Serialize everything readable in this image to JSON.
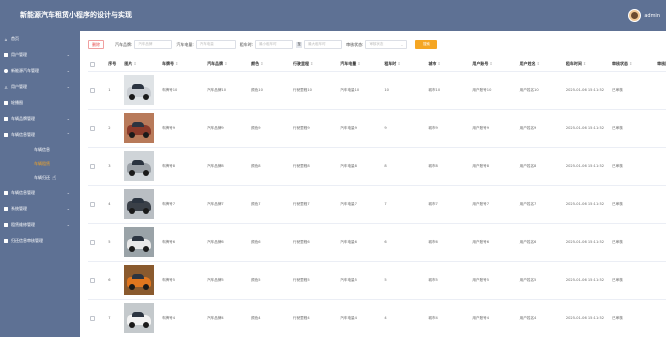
{
  "app": {
    "title": "新能源汽车租赁小程序的设计与实现",
    "user_name": "admin",
    "accent_color": "#f5a623",
    "theme_color": "#5e7194"
  },
  "sidebar": {
    "items": [
      {
        "label": "首页",
        "icon": "home-icon"
      },
      {
        "label": "用户管理",
        "icon": "users-icon",
        "has_children": true
      },
      {
        "label": "新能源汽车管理",
        "icon": "car-icon",
        "has_children": true
      },
      {
        "label": "用户管理",
        "icon": "person-icon",
        "has_children": true
      },
      {
        "label": "轮播图",
        "icon": "image-icon"
      },
      {
        "label": "车辆品牌管理",
        "icon": "tag-icon",
        "has_children": true
      },
      {
        "label": "车辆信息管理",
        "icon": "list-icon",
        "has_children": true,
        "expanded": true,
        "children": [
          {
            "label": "车辆信息",
            "active": false
          },
          {
            "label": "车辆租赁",
            "active": true
          },
          {
            "label": "车辆归还",
            "active": false
          }
        ]
      },
      {
        "label": "车辆信息管理",
        "icon": "list-icon",
        "has_children": true
      },
      {
        "label": "系统管理",
        "icon": "settings-icon",
        "has_children": true
      },
      {
        "label": "租赁维修管理",
        "icon": "wrench-icon",
        "has_children": true
      },
      {
        "label": "归还信息审核管理",
        "icon": "check-icon"
      }
    ]
  },
  "toolbar": {
    "delete_label": "删除",
    "filters": [
      {
        "label": "汽车品牌:",
        "placeholder": "汽车品牌"
      },
      {
        "label": "汽车电量:",
        "placeholder": "汽车电量"
      }
    ],
    "range": {
      "label": "租车时:",
      "from_placeholder": "最小租车时",
      "sep": "至",
      "to_placeholder": "最大租车时"
    },
    "status_filter": {
      "label": "审核状态:",
      "placeholder": "审核状态"
    },
    "search_label": "搜索"
  },
  "table": {
    "columns": [
      "",
      "序号",
      "图片",
      "车牌号",
      "汽车品牌",
      "颜色",
      "行驶里程",
      "汽车电量",
      "租车时",
      "城市",
      "用户账号",
      "用户姓名",
      "租车时间",
      "审核状态",
      "审核回复"
    ],
    "sortable": [
      false,
      false,
      true,
      true,
      true,
      true,
      true,
      true,
      true,
      true,
      true,
      true,
      true,
      true,
      false
    ],
    "rows": [
      {
        "no": "1",
        "car_color": "#c9cdd2",
        "bg": "#dfe3e6",
        "plate": "车牌号10",
        "brand": "汽车品牌10",
        "color": "颜色10",
        "mileage": "行驶里程10",
        "battery": "汽车电量10",
        "hours": "10",
        "city": "城市10",
        "account": "用户账号10",
        "name": "用户姓名10",
        "time": "2025-01-06 15:11:52",
        "status": "已审核"
      },
      {
        "no": "2",
        "car_color": "#8a3a2a",
        "bg": "#b87a5a",
        "plate": "车牌号9",
        "brand": "汽车品牌9",
        "color": "颜色9",
        "mileage": "行驶里程9",
        "battery": "汽车电量9",
        "hours": "9",
        "city": "城市9",
        "account": "用户账号9",
        "name": "用户姓名9",
        "time": "2025-01-06 15:11:52",
        "status": "已审核"
      },
      {
        "no": "3",
        "car_color": "#9aa0a6",
        "bg": "#cfd4d8",
        "plate": "车牌号8",
        "brand": "汽车品牌8",
        "color": "颜色8",
        "mileage": "行驶里程8",
        "battery": "汽车电量8",
        "hours": "8",
        "city": "城市8",
        "account": "用户账号8",
        "name": "用户姓名8",
        "time": "2025-01-06 15:11:52",
        "status": "已审核"
      },
      {
        "no": "4",
        "car_color": "#3a4048",
        "bg": "#b9bec3",
        "plate": "车牌号7",
        "brand": "汽车品牌7",
        "color": "颜色7",
        "mileage": "行驶里程7",
        "battery": "汽车电量7",
        "hours": "7",
        "city": "城市7",
        "account": "用户账号7",
        "name": "用户姓名7",
        "time": "2025-01-06 15:11:52",
        "status": "已审核"
      },
      {
        "no": "5",
        "car_color": "#e8e8e8",
        "bg": "#9aa3a8",
        "plate": "车牌号6",
        "brand": "汽车品牌6",
        "color": "颜色6",
        "mileage": "行驶里程6",
        "battery": "汽车电量6",
        "hours": "6",
        "city": "城市6",
        "account": "用户账号6",
        "name": "用户姓名6",
        "time": "2025-01-06 15:11:52",
        "status": "已审核"
      },
      {
        "no": "6",
        "car_color": "#e0761e",
        "bg": "#8a5a2e",
        "plate": "车牌号5",
        "brand": "汽车品牌5",
        "color": "颜色5",
        "mileage": "行驶里程5",
        "battery": "汽车电量5",
        "hours": "5",
        "city": "城市5",
        "account": "用户账号5",
        "name": "用户姓名5",
        "time": "2025-01-06 15:11:52",
        "status": "已审核"
      },
      {
        "no": "7",
        "car_color": "#f2f2f2",
        "bg": "#c4c9cc",
        "plate": "车牌号4",
        "brand": "汽车品牌4",
        "color": "颜色4",
        "mileage": "行驶里程4",
        "battery": "汽车电量4",
        "hours": "4",
        "city": "城市4",
        "account": "用户账号4",
        "name": "用户姓名4",
        "time": "2025-01-06 15:11:52",
        "status": "已审核"
      }
    ]
  }
}
